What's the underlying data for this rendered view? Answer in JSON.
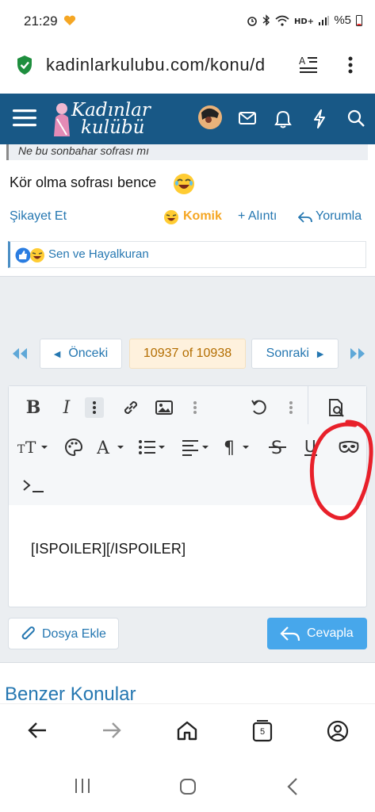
{
  "status_bar": {
    "time": "21:29",
    "battery": "%5"
  },
  "browser": {
    "url": "kadinlarkulubu.com/konu/d",
    "tab_count": "5"
  },
  "site": {
    "logo_line1": "Kadınlar",
    "logo_line2": "kulübü"
  },
  "post": {
    "quote_text": "Ne bu sonbahar sofrası mı",
    "body_text": "Kör olma sofrası bence",
    "actions": {
      "report": "Şikayet Et",
      "reaction": "Komik",
      "quote": "+ Alıntı",
      "reply": "Yorumla"
    },
    "reactions_text": "Sen ve Hayalkuran"
  },
  "pagination": {
    "previous": "Önceki",
    "current": "10937 of 10938",
    "next": "Sonraki"
  },
  "editor": {
    "content": "[ISPOILER][/ISPOILER]",
    "attach_label": "Dosya Ekle",
    "submit_label": "Cevapla"
  },
  "similar_threads_title": "Benzer Konular",
  "colors": {
    "header_bg": "#185886",
    "link": "#2577b1",
    "submit_bg": "#47a7eb",
    "highlight_circle": "#e8202a"
  }
}
